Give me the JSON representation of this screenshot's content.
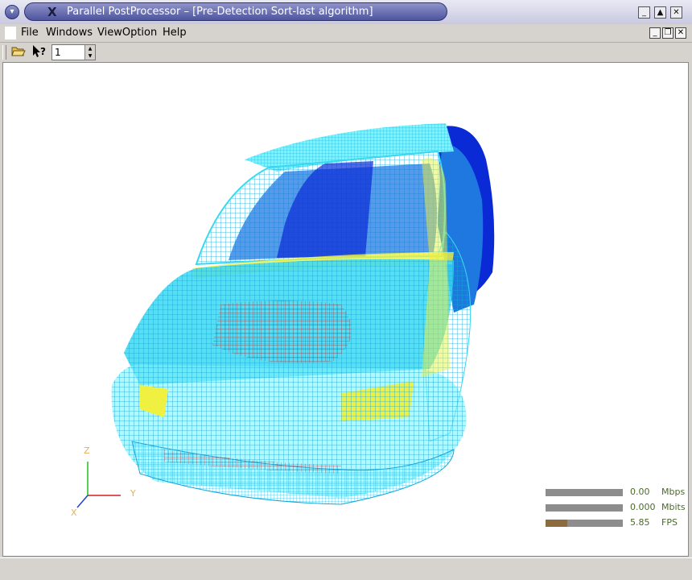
{
  "window": {
    "title": "Parallel PostProcessor – [Pre-Detection Sort-last algorithm]",
    "logo": "X"
  },
  "menubar": {
    "items": [
      {
        "label": "File"
      },
      {
        "label": "Windows"
      },
      {
        "label": "ViewOption"
      },
      {
        "label": "Help"
      }
    ]
  },
  "toolbar": {
    "open_icon": "open-folder-icon",
    "help_icon": "whats-this-help-icon",
    "spin_value": "1"
  },
  "viewport": {
    "axes": {
      "x": "X",
      "y": "Y",
      "z": "Z"
    },
    "stats": [
      {
        "value": "0.00",
        "unit": "Mbps",
        "level": 0.0
      },
      {
        "value": "0.000",
        "unit": "Mbits",
        "level": 0.0
      },
      {
        "value": "5.85",
        "unit": "FPS",
        "level": 0.28
      }
    ]
  },
  "colors": {
    "mesh_cyan": "#38d8f0",
    "mesh_light": "#7ef2f8",
    "mesh_blue": "#1e78e0",
    "mesh_dark_blue": "#0a2ad6",
    "mesh_yellow": "#f0f040",
    "mesh_red": "#c01818"
  }
}
